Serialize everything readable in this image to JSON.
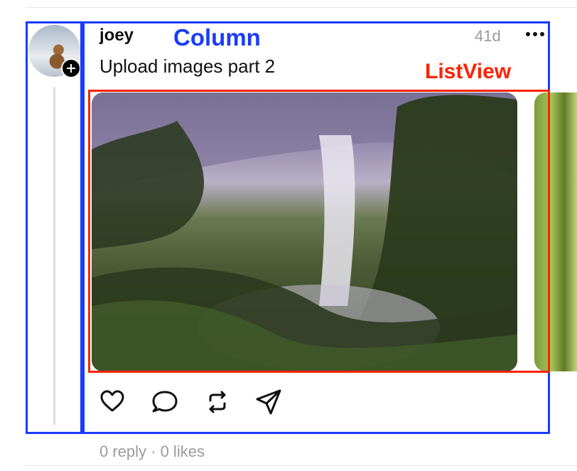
{
  "post": {
    "username": "joey",
    "timestamp": "41d",
    "text": "Upload images part 2",
    "stats": "0 reply · 0 likes"
  },
  "annotations": {
    "column_label": "Column",
    "listview_label": "ListView"
  },
  "icons": {
    "more": "ellipsis-icon",
    "like": "heart-icon",
    "comment": "comment-icon",
    "repost": "repost-icon",
    "share": "send-icon",
    "avatar_badge": "plus-icon"
  },
  "colors": {
    "column_outline": "#1a3cff",
    "listview_outline": "#ff2200",
    "muted_text": "#9b9b9b"
  }
}
